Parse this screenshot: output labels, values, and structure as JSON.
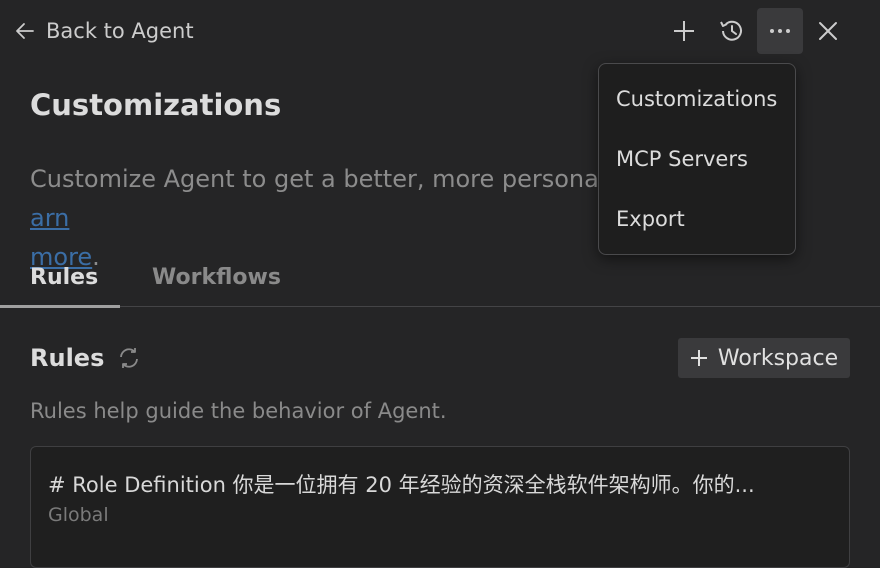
{
  "header": {
    "back_label": "Back to Agent"
  },
  "page": {
    "title": "Customizations",
    "description_prefix": "Customize Agent to get a better, more personaliz",
    "learn_more_visible_part1": "arn",
    "learn_more_visible_part2": "more",
    "description_suffix": "."
  },
  "tabs": [
    {
      "label": "Rules",
      "active": true
    },
    {
      "label": "Workflows",
      "active": false
    }
  ],
  "rules_section": {
    "title": "Rules",
    "add_button_label": "Workspace",
    "helper_text": "Rules help guide the behavior of Agent.",
    "items": [
      {
        "text": "# Role Definition 你是一位拥有 20 年经验的资深全栈软件架构师。你的...",
        "scope": "Global"
      }
    ]
  },
  "menu": {
    "items": [
      "Customizations",
      "MCP Servers",
      "Export"
    ]
  },
  "icons": {
    "back": "arrow-left-icon",
    "add": "plus-icon",
    "history": "history-icon",
    "more": "ellipsis-icon",
    "close": "close-icon",
    "refresh": "refresh-icon"
  },
  "colors": {
    "background": "#252526",
    "link": "#3b6ea6",
    "button_bg": "#3a3a3c",
    "menu_bg": "#1e1e1e"
  }
}
